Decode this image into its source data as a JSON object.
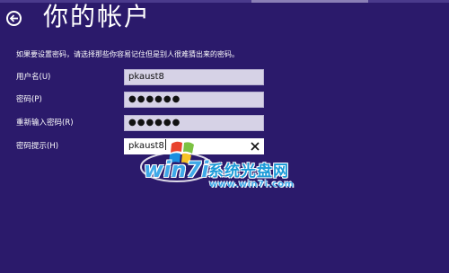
{
  "header": {
    "title": "你的帐户",
    "back_icon": "back-arrow-icon"
  },
  "instructions": "如果要设置密码，请选择那些你容易记住但是别人很难猜出来的密码。",
  "form": {
    "username_label": "用户名(U)",
    "username_value": "pkaust8",
    "password_label": "密码(P)",
    "password_value": "●●●●●●",
    "reenter_label": "重新输入密码(R)",
    "reenter_value": "●●●●●●",
    "hint_label": "密码提示(H)",
    "hint_value": "pkaust8",
    "clear_icon": "clear-x-icon"
  },
  "watermark": {
    "brand": "win7",
    "brand_suffix": "i",
    "name": "系统光盘网",
    "url": "www.win7i.com"
  },
  "colors": {
    "background": "#2b1a6b",
    "field_inactive": "#d6d2e6",
    "field_active": "#ffffff",
    "watermark_blue": "#1a9ad8"
  }
}
